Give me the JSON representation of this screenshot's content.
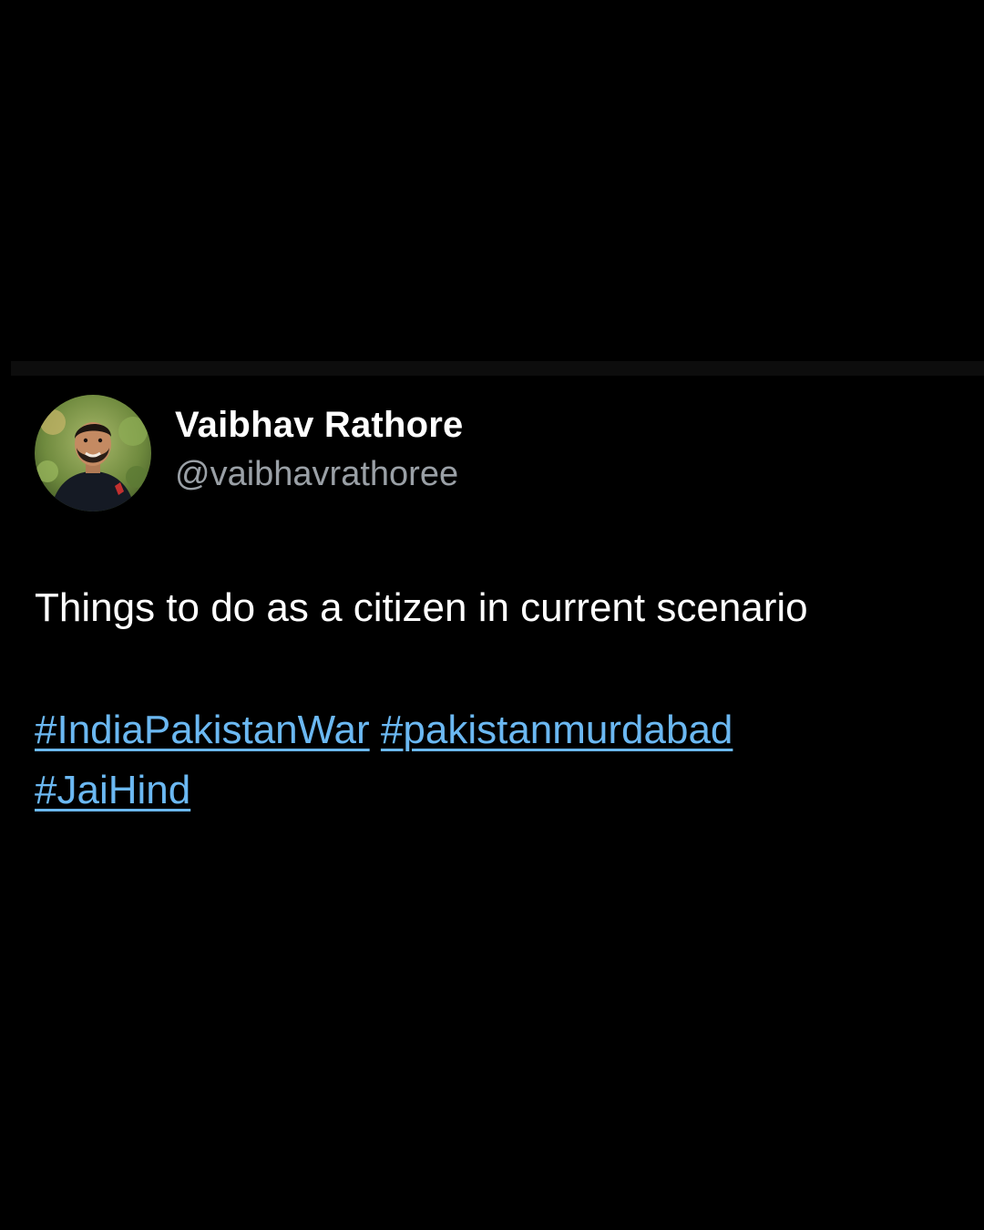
{
  "tweet": {
    "author": {
      "display_name": "Vaibhav Rathore",
      "handle": "@vaibhavrathoree",
      "avatar_icon": "profile-photo"
    },
    "text": "Things to do as a citizen in current scenario",
    "hashtags": [
      "#IndiaPakistanWar",
      "#pakistanmurdabad",
      "#JaiHind"
    ]
  },
  "colors": {
    "background": "#000000",
    "text": "#ffffff",
    "handle": "#9aa0a6",
    "hashtag": "#6bb8f2"
  }
}
